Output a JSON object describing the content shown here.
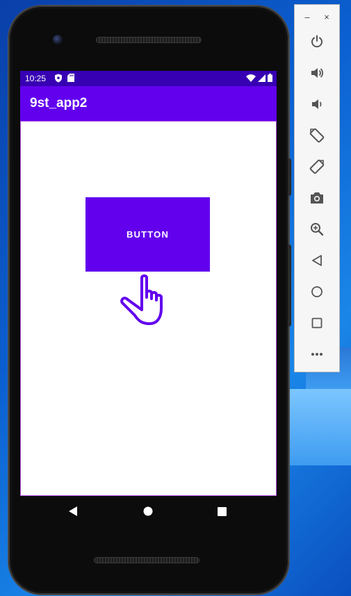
{
  "status_bar": {
    "time": "10:25",
    "left_icons": [
      "shield-icon",
      "sd-card-icon"
    ],
    "right_icons": [
      "wifi-icon",
      "signal-icon",
      "battery-icon"
    ]
  },
  "app_bar": {
    "title": "9st_app2"
  },
  "content": {
    "button_label": "BUTTON"
  },
  "nav_bar": {
    "items": [
      "back-icon",
      "home-icon",
      "recents-icon"
    ]
  },
  "emulator_toolbar": {
    "minimize": "–",
    "close": "×",
    "buttons": [
      "power-icon",
      "volume-up-icon",
      "volume-down-icon",
      "rotate-left-icon",
      "rotate-right-icon",
      "camera-icon",
      "zoom-icon",
      "back-icon",
      "home-icon",
      "overview-icon",
      "more-icon"
    ]
  },
  "colors": {
    "primary": "#6200ee",
    "primary_dark": "#3700b3",
    "on_primary": "#ffffff",
    "toolbar_icon": "#555555"
  }
}
